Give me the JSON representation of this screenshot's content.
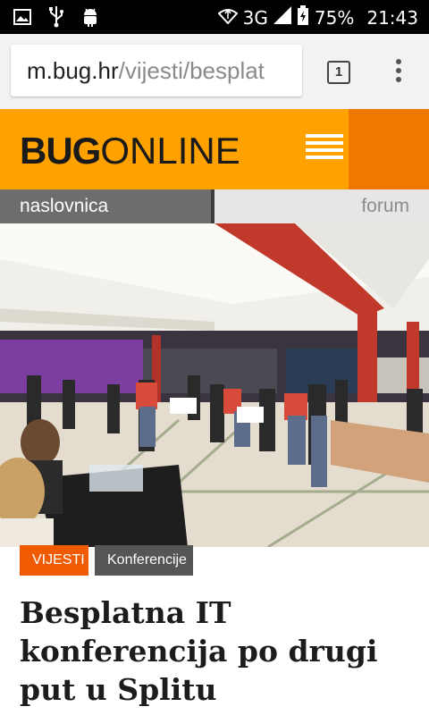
{
  "status_bar": {
    "network": "3G",
    "battery": "75%",
    "time": "21:43",
    "icons": [
      "image-icon",
      "usb-icon",
      "android-icon",
      "data-sync-icon",
      "signal-icon",
      "battery-icon"
    ]
  },
  "browser": {
    "url_host": "m.bug.hr",
    "url_path": "/vijesti/besplat",
    "tab_count": "1",
    "load_progress": 0.67
  },
  "site": {
    "logo_bold": "BUG",
    "logo_light": "ONLINE",
    "menu_icon": "hamburger-menu-icon",
    "colors": {
      "header": "#ffa200",
      "menu_bg": "#f07800",
      "tag_news": "#f05a00"
    }
  },
  "nav": {
    "home": "naslovnica",
    "forum": "forum"
  },
  "article": {
    "tag_section": "VIJESTI",
    "tag_category": "Konferencije",
    "title": "Besplatna IT konferencija po drugi put u Splitu"
  }
}
